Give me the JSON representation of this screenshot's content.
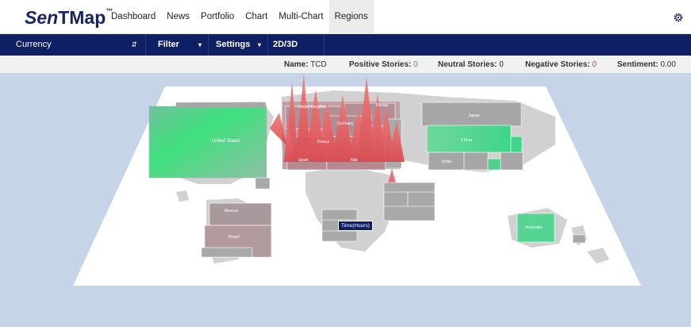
{
  "app": {
    "logo_italic": "Sen",
    "logo_rest": "TMap",
    "logo_tm": "™"
  },
  "nav": {
    "items": [
      "Dashboard",
      "News",
      "Portfolio",
      "Chart",
      "Multi-Chart",
      "Regions"
    ],
    "active": "Regions"
  },
  "toolbar": {
    "currency": "Currency",
    "filter": "Filter",
    "settings": "Settings",
    "mode": "2D/3D"
  },
  "stats": {
    "name_label": "Name:",
    "name_value": "TCD",
    "positive_label": "Positive Stories:",
    "positive_value": "0",
    "neutral_label": "Neutral Stories:",
    "neutral_value": "0",
    "negative_label": "Negative Stories:",
    "negative_value": "0",
    "sentiment_label": "Sentiment:",
    "sentiment_value": "0.00"
  },
  "regions": {
    "usa": "United States",
    "uk": "United Kingdom",
    "russia": "Russia",
    "germany": "Germany",
    "france": "France",
    "spain": "Spain",
    "italy": "Italy",
    "japan": "Japan",
    "china": "China",
    "india": "India",
    "mexico": "Mexico",
    "brazil": "Brazil",
    "australia": "Australia"
  },
  "tooltip": "Time(Hours)",
  "colors": {
    "brand_navy": "#0f1f63",
    "positive": "#2aa84a",
    "negative": "#e03a3a",
    "map_bg": "#c5d4e6"
  },
  "icons": {
    "settings": "gear-icon"
  }
}
